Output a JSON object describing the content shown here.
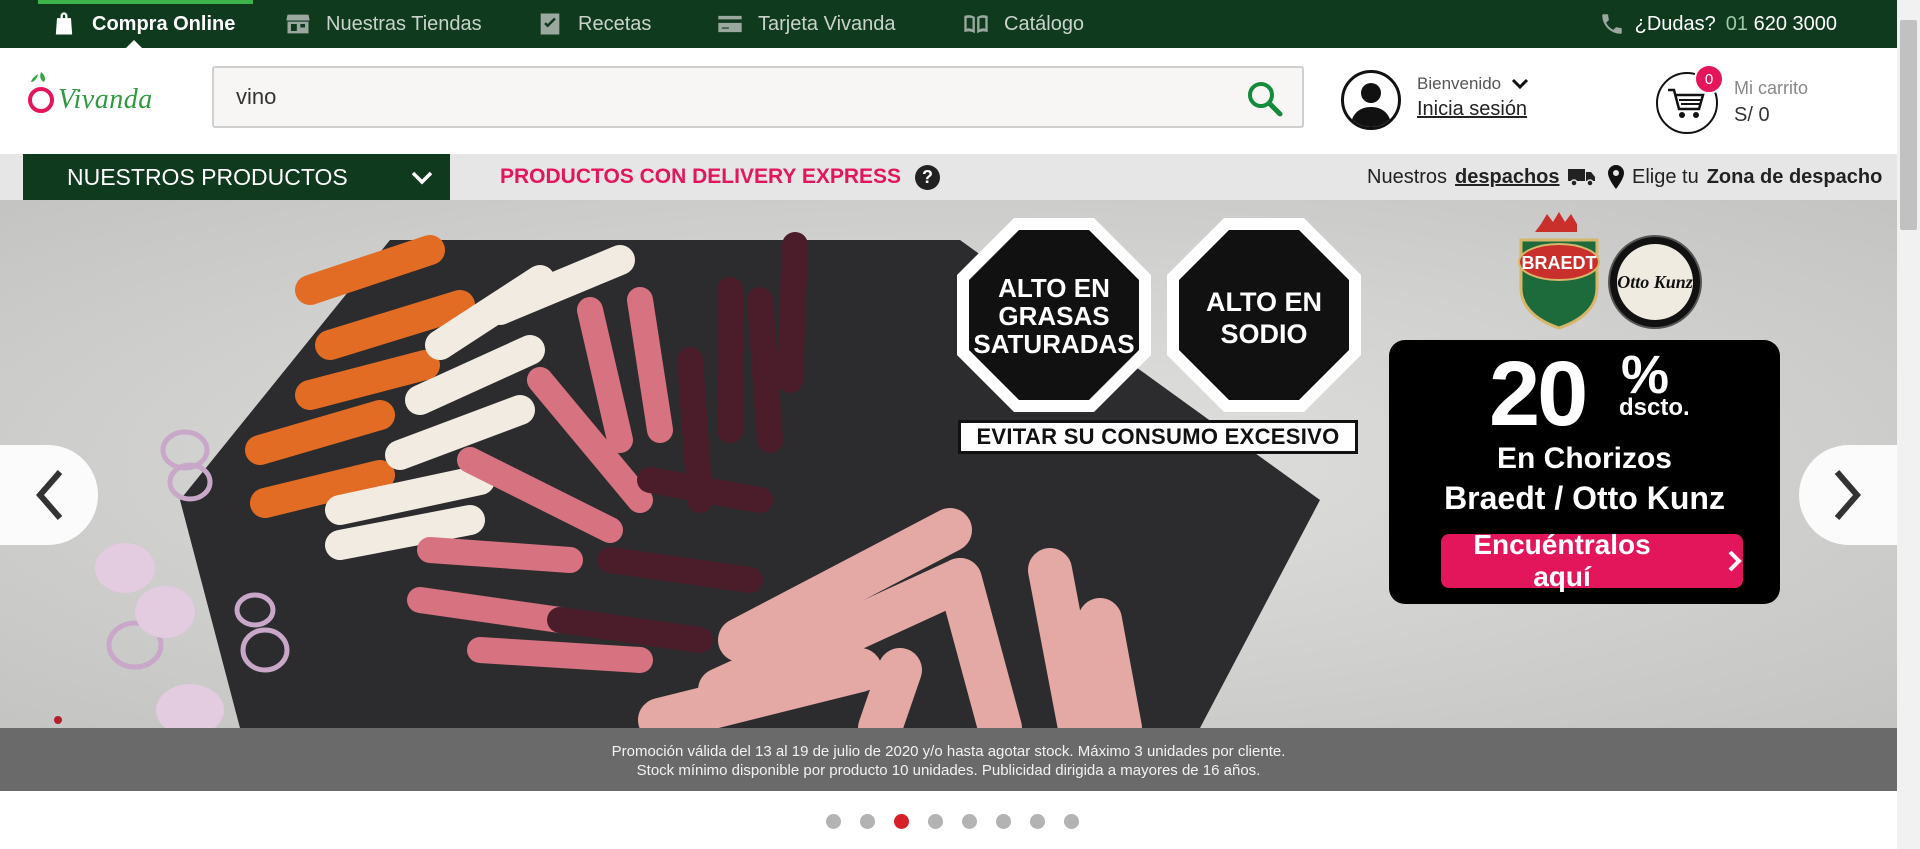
{
  "topnav": {
    "tabs": [
      {
        "label": "Compra Online",
        "icon": "shopping-bag-icon",
        "active": true
      },
      {
        "label": "Nuestras Tiendas",
        "icon": "store-icon",
        "active": false
      },
      {
        "label": "Recetas",
        "icon": "recipe-check-icon",
        "active": false
      },
      {
        "label": "Tarjeta Vivanda",
        "icon": "card-icon",
        "active": false
      },
      {
        "label": "Catálogo",
        "icon": "book-icon",
        "active": false
      }
    ],
    "help": {
      "label": "¿Dudas?",
      "phone_prefix": "01",
      "phone": "620 3000",
      "icon": "phone-icon"
    }
  },
  "header": {
    "logo": "Vivanda",
    "search": {
      "value": "vino",
      "icon": "search-icon"
    },
    "user": {
      "greeting": "Bienvenido",
      "login": "Inicia sesión"
    },
    "cart": {
      "count": "0",
      "label": "Mi carrito",
      "total": "S/ 0"
    }
  },
  "catbar": {
    "products_button": "NUESTROS PRODUCTOS",
    "delivery_express": "PRODUCTOS CON DELIVERY EXPRESS",
    "help_mark": "?",
    "despachos_prefix": "Nuestros",
    "despachos_link": "despachos",
    "zona_prefix": "Elige tu",
    "zona_bold": "Zona de despacho"
  },
  "banner": {
    "warning_1": [
      "ALTO EN",
      "GRASAS",
      "SATURADAS"
    ],
    "warning_2": [
      "ALTO EN",
      "SODIO"
    ],
    "warning_footer": "EVITAR SU CONSUMO EXCESIVO",
    "brands": [
      "BRAEDT",
      "Otto Kunz"
    ],
    "promo": {
      "percent": "20",
      "percent_sign": "%",
      "dscto": "dscto.",
      "line1": "En Chorizos",
      "line2": "Braedt / Otto Kunz",
      "cta": "Encuéntralos aquí"
    },
    "legal_line1": "Promoción válida del 13 al 19 de julio de 2020 y/o hasta agotar stock. Máximo 3 unidades por cliente.",
    "legal_line2": "Stock mínimo disponible por producto 10 unidades. Publicidad dirigida a mayores de 16 años."
  },
  "carousel": {
    "total_slides": 8,
    "active_slide": 3
  },
  "colors": {
    "brand_green": "#0f3a1d",
    "accent_pink": "#e3165b",
    "dot_active": "#d52027"
  }
}
